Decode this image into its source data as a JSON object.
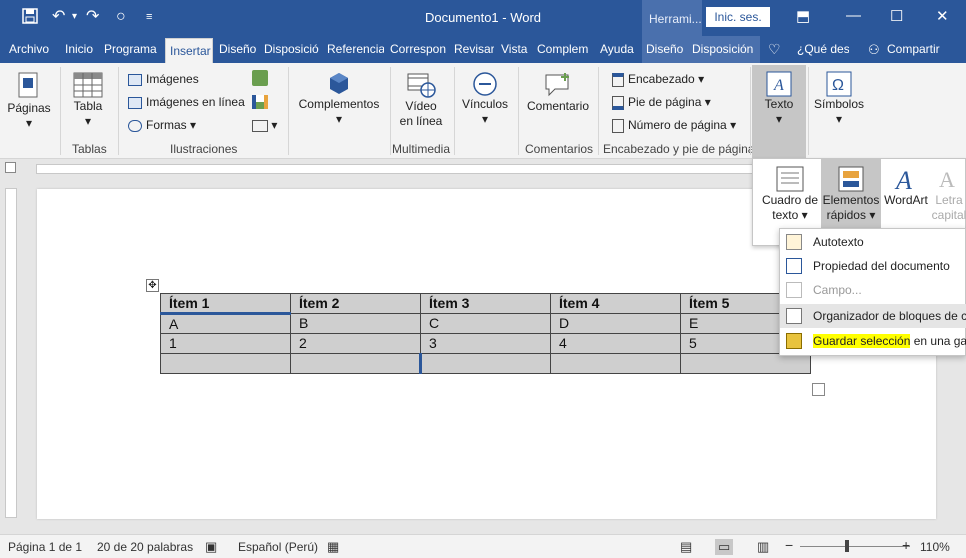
{
  "window": {
    "title": "Documento1  -  Word",
    "context_tab": "Herrami...",
    "sign_in": "Inic. ses."
  },
  "tabs": [
    "Archivo",
    "Inicio",
    "Programa",
    "Insertar",
    "Diseño",
    "Disposició",
    "Referencia",
    "Correspon",
    "Revisar",
    "Vista",
    "Complem",
    "Ayuda",
    "Diseño",
    "Disposición"
  ],
  "tell_me": "¿Qué des",
  "share": "Compartir",
  "ribbon": {
    "paginas": "Páginas",
    "tabla": "Tabla",
    "tablas_group": "Tablas",
    "imagenes": "Imágenes",
    "imagenes_linea": "Imágenes en línea",
    "formas": "Formas",
    "ilustraciones_group": "Ilustraciones",
    "complementos": "Complementos",
    "video1": "Vídeo",
    "video2": "en línea",
    "multimedia_group": "Multimedia",
    "vinculos": "Vínculos",
    "comentario": "Comentario",
    "comentarios_group": "Comentarios",
    "encabezado": "Encabezado",
    "pie": "Pie de página",
    "numero": "Número de página",
    "encabezado_group": "Encabezado y pie de página",
    "texto": "Texto",
    "simbolos": "Símbolos"
  },
  "text_popup": {
    "cuadro1": "Cuadro de",
    "cuadro2": "texto",
    "elementos1": "Elementos",
    "elementos2": "rápidos",
    "wordart": "WordArt",
    "letra1": "Letra",
    "letra2": "capital"
  },
  "menu": {
    "autotexto": "Autotexto",
    "propiedad": "Propiedad del documento",
    "campo": "Campo...",
    "organizador": "Organizador de bloques de cr",
    "guardar_hl": "Guardar selección",
    "guardar_rest": " en una gale"
  },
  "table": {
    "headers": [
      "Ítem 1",
      "Ítem 2",
      "Ítem 3",
      "Ítem 4",
      "Ítem 5"
    ],
    "rows": [
      [
        "A",
        "B",
        "C",
        "D",
        "E"
      ],
      [
        "1",
        "2",
        "3",
        "4",
        "5"
      ],
      [
        "",
        "",
        "",
        "",
        ""
      ]
    ]
  },
  "status": {
    "page": "Página 1 de 1",
    "words": "20 de 20 palabras",
    "lang": "Español (Perú)",
    "zoom": "110%"
  }
}
